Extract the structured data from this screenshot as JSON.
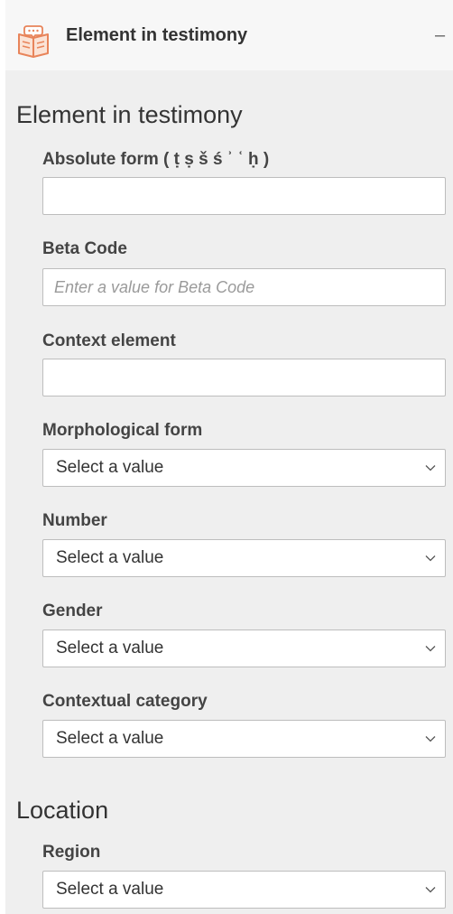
{
  "header": {
    "title": "Element in testimony",
    "icon": "book-icon",
    "collapse_label": "–"
  },
  "element_section": {
    "title": "Element in testimony",
    "absolute_form": {
      "label": "Absolute form ( ṭ ṣ š ś ʾ ʿ ḥ )",
      "value": ""
    },
    "beta_code": {
      "label": "Beta Code",
      "placeholder": "Enter a value for Beta Code",
      "value": ""
    },
    "context_element": {
      "label": "Context element",
      "value": ""
    },
    "morphological_form": {
      "label": "Morphological form",
      "selected": "Select a value"
    },
    "number": {
      "label": "Number",
      "selected": "Select a value"
    },
    "gender": {
      "label": "Gender",
      "selected": "Select a value"
    },
    "contextual_category": {
      "label": "Contextual category",
      "selected": "Select a value"
    }
  },
  "location_section": {
    "title": "Location",
    "region": {
      "label": "Region",
      "selected": "Select a value"
    }
  },
  "colors": {
    "panel_bg": "#efefef",
    "header_bg": "#f7f7f7",
    "icon_accent": "#e8845a",
    "border": "#bdbdbd"
  }
}
